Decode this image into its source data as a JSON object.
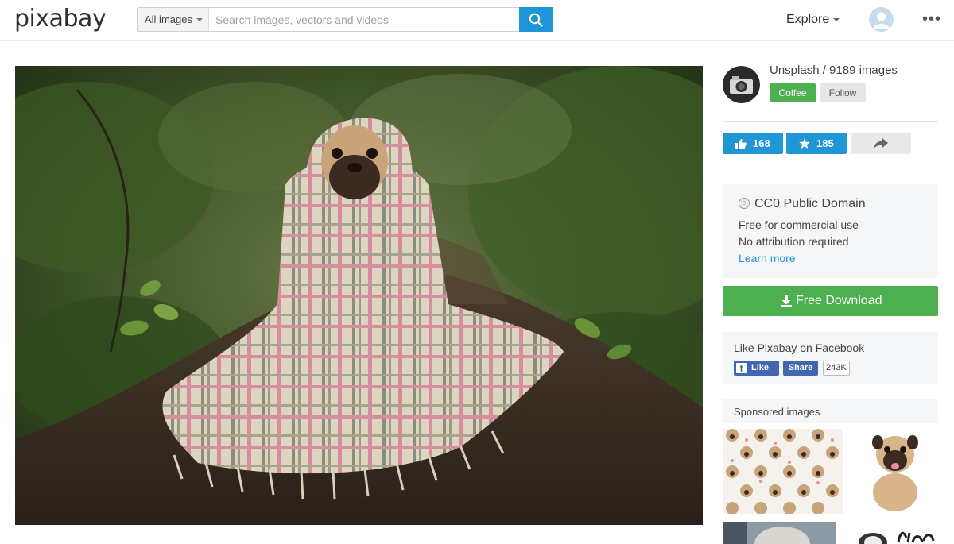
{
  "header": {
    "logo": "pixabay",
    "search_type": "All images",
    "search_placeholder": "Search images, vectors and videos",
    "explore": "Explore",
    "more": "•••"
  },
  "profile": {
    "name": "Unsplash / 9189 images",
    "coffee_label": "Coffee",
    "follow_label": "Follow"
  },
  "actions": {
    "likes": "168",
    "favorites": "185"
  },
  "license": {
    "icon": "⓪",
    "title": "CC0 Public Domain",
    "line1": "Free for commercial use",
    "line2": "No attribution required",
    "link": "Learn more"
  },
  "download": {
    "label": "Free Download"
  },
  "facebook": {
    "title": "Like Pixabay on Facebook",
    "like": "Like",
    "share": "Share",
    "count": "243K"
  },
  "sponsored": {
    "label": "Sponsored images"
  },
  "colors": {
    "primary_blue": "#2196d6",
    "green": "#4caf50",
    "facebook_blue": "#4267b2"
  },
  "icons": [
    "search-icon",
    "user-icon",
    "thumbs-up-icon",
    "star-icon",
    "share-arrow-icon",
    "download-icon"
  ]
}
